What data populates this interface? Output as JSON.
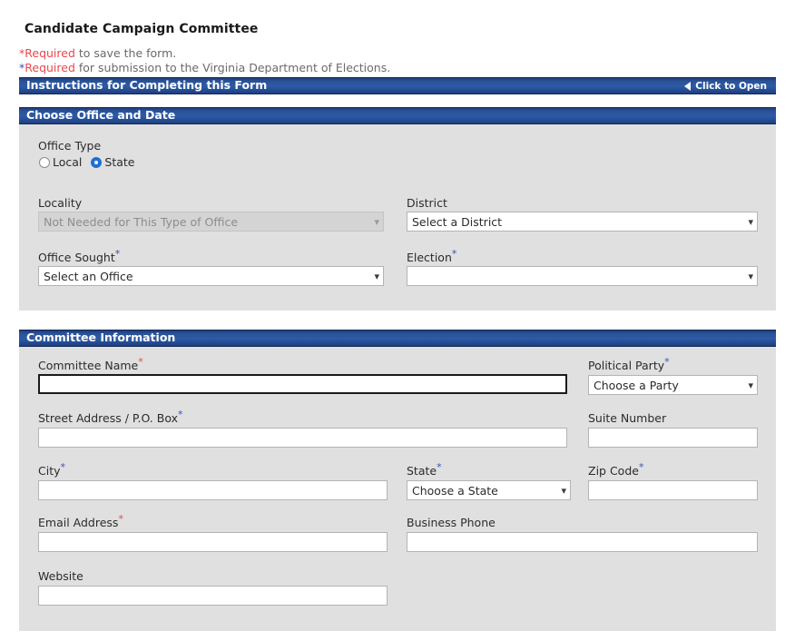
{
  "document": {
    "title": "Candidate Campaign Committee",
    "required_notes": [
      {
        "asterisk": "*",
        "asterisk_color": "#e8484f",
        "required_word": "Required",
        "rest": " to save the form."
      },
      {
        "asterisk": "*",
        "asterisk_color": "#3b4fb5",
        "required_word": "Required",
        "rest": " for submission to the Virginia Department of Elections."
      }
    ]
  },
  "instructions_bar": {
    "title": "Instructions for Completing this Form",
    "toggle_label": "Click to Open",
    "toggle_icon": "triangle-left-icon",
    "bar_color": "#2a5196"
  },
  "office_section": {
    "header": "Choose Office and Date",
    "office_type": {
      "label": "Office Type",
      "options": [
        {
          "label": "Local",
          "selected": false
        },
        {
          "label": "State",
          "selected": true
        }
      ]
    },
    "locality": {
      "label": "Locality",
      "value": "Not Needed for This Type of Office",
      "disabled": true,
      "required": "none"
    },
    "district": {
      "label": "District",
      "value": "Select a District",
      "disabled": false,
      "required": "none"
    },
    "office_sought": {
      "label": "Office Sought",
      "value": "Select an Office",
      "disabled": false,
      "required": "submission"
    },
    "election": {
      "label": "Election",
      "value": "",
      "disabled": false,
      "required": "submission"
    }
  },
  "committee_section": {
    "header": "Committee Information",
    "committee_name": {
      "label": "Committee Name",
      "value": "",
      "placeholder": "",
      "required": "save",
      "focused": true
    },
    "political_party": {
      "label": "Political Party",
      "value": "Choose a Party",
      "required": "submission"
    },
    "street_address": {
      "label": "Street Address / P.O. Box",
      "value": "",
      "placeholder": "",
      "required": "submission"
    },
    "suite_number": {
      "label": "Suite Number",
      "value": "",
      "placeholder": "",
      "required": "none"
    },
    "city": {
      "label": "City",
      "value": "",
      "placeholder": "",
      "required": "submission"
    },
    "state": {
      "label": "State",
      "value": "Choose a State",
      "required": "submission"
    },
    "zip_code": {
      "label": "Zip Code",
      "value": "",
      "placeholder": "",
      "required": "submission"
    },
    "email_address": {
      "label": "Email Address",
      "value": "",
      "placeholder": "",
      "required": "save"
    },
    "business_phone": {
      "label": "Business Phone",
      "value": "",
      "placeholder": "",
      "required": "none"
    },
    "website": {
      "label": "Website",
      "value": "",
      "placeholder": "",
      "required": "none"
    }
  },
  "colors": {
    "panel_bg": "#e0e0e0",
    "bar_blue": "#2a5196",
    "required_red": "#e8484f",
    "required_blue": "#3b4fb5",
    "radio_selected": "#1c6fd4"
  }
}
